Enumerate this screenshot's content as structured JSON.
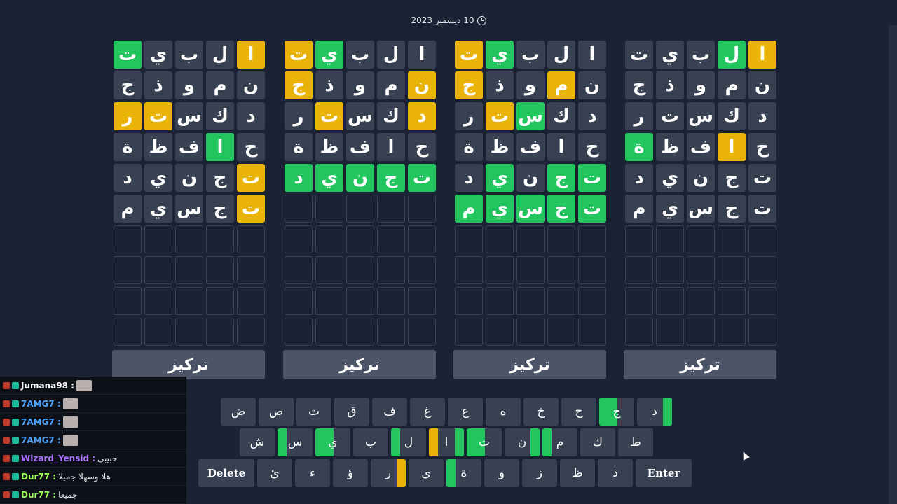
{
  "header": {
    "date": "10 ديسمبر 2023"
  },
  "boards": [
    {
      "focus_label": "تركيز",
      "rows": [
        [
          {
            "l": "ا",
            "s": "y"
          },
          {
            "l": "ل",
            "s": "g"
          },
          {
            "l": "ب",
            "s": "c"
          },
          {
            "l": "ي",
            "s": "c"
          },
          {
            "l": "ت",
            "s": "c"
          }
        ],
        [
          {
            "l": "ن",
            "s": "c"
          },
          {
            "l": "م",
            "s": "c"
          },
          {
            "l": "و",
            "s": "c"
          },
          {
            "l": "ذ",
            "s": "c"
          },
          {
            "l": "ج",
            "s": "c"
          }
        ],
        [
          {
            "l": "د",
            "s": "c"
          },
          {
            "l": "ك",
            "s": "c"
          },
          {
            "l": "س",
            "s": "c"
          },
          {
            "l": "ت",
            "s": "c"
          },
          {
            "l": "ر",
            "s": "c"
          }
        ],
        [
          {
            "l": "ح",
            "s": "c"
          },
          {
            "l": "ا",
            "s": "y"
          },
          {
            "l": "ف",
            "s": "c"
          },
          {
            "l": "ظ",
            "s": "c"
          },
          {
            "l": "ة",
            "s": "g"
          }
        ],
        [
          {
            "l": "ت",
            "s": "c"
          },
          {
            "l": "ج",
            "s": "c"
          },
          {
            "l": "ن",
            "s": "c"
          },
          {
            "l": "ي",
            "s": "c"
          },
          {
            "l": "د",
            "s": "c"
          }
        ],
        [
          {
            "l": "ت",
            "s": "c"
          },
          {
            "l": "ج",
            "s": "c"
          },
          {
            "l": "س",
            "s": "c"
          },
          {
            "l": "ي",
            "s": "c"
          },
          {
            "l": "م",
            "s": "c"
          }
        ]
      ]
    },
    {
      "focus_label": "تركيز",
      "rows": [
        [
          {
            "l": "ا",
            "s": "c"
          },
          {
            "l": "ل",
            "s": "c"
          },
          {
            "l": "ب",
            "s": "c"
          },
          {
            "l": "ي",
            "s": "g"
          },
          {
            "l": "ت",
            "s": "y"
          }
        ],
        [
          {
            "l": "ن",
            "s": "c"
          },
          {
            "l": "م",
            "s": "y"
          },
          {
            "l": "و",
            "s": "c"
          },
          {
            "l": "ذ",
            "s": "c"
          },
          {
            "l": "ج",
            "s": "y"
          }
        ],
        [
          {
            "l": "د",
            "s": "c"
          },
          {
            "l": "ك",
            "s": "c"
          },
          {
            "l": "س",
            "s": "g"
          },
          {
            "l": "ت",
            "s": "y"
          },
          {
            "l": "ر",
            "s": "c"
          }
        ],
        [
          {
            "l": "ح",
            "s": "c"
          },
          {
            "l": "ا",
            "s": "c"
          },
          {
            "l": "ف",
            "s": "c"
          },
          {
            "l": "ظ",
            "s": "c"
          },
          {
            "l": "ة",
            "s": "c"
          }
        ],
        [
          {
            "l": "ت",
            "s": "g"
          },
          {
            "l": "ج",
            "s": "g"
          },
          {
            "l": "ن",
            "s": "c"
          },
          {
            "l": "ي",
            "s": "g"
          },
          {
            "l": "د",
            "s": "c"
          }
        ],
        [
          {
            "l": "ت",
            "s": "g"
          },
          {
            "l": "ج",
            "s": "g"
          },
          {
            "l": "س",
            "s": "g"
          },
          {
            "l": "ي",
            "s": "g"
          },
          {
            "l": "م",
            "s": "g"
          }
        ]
      ]
    },
    {
      "focus_label": "تركيز",
      "rows": [
        [
          {
            "l": "ا",
            "s": "c"
          },
          {
            "l": "ل",
            "s": "c"
          },
          {
            "l": "ب",
            "s": "c"
          },
          {
            "l": "ي",
            "s": "g"
          },
          {
            "l": "ت",
            "s": "y"
          }
        ],
        [
          {
            "l": "ن",
            "s": "y"
          },
          {
            "l": "م",
            "s": "c"
          },
          {
            "l": "و",
            "s": "c"
          },
          {
            "l": "ذ",
            "s": "c"
          },
          {
            "l": "ج",
            "s": "y"
          }
        ],
        [
          {
            "l": "د",
            "s": "y"
          },
          {
            "l": "ك",
            "s": "c"
          },
          {
            "l": "س",
            "s": "c"
          },
          {
            "l": "ت",
            "s": "y"
          },
          {
            "l": "ر",
            "s": "c"
          }
        ],
        [
          {
            "l": "ح",
            "s": "c"
          },
          {
            "l": "ا",
            "s": "c"
          },
          {
            "l": "ف",
            "s": "c"
          },
          {
            "l": "ظ",
            "s": "c"
          },
          {
            "l": "ة",
            "s": "c"
          }
        ],
        [
          {
            "l": "ت",
            "s": "g"
          },
          {
            "l": "ج",
            "s": "g"
          },
          {
            "l": "ن",
            "s": "g"
          },
          {
            "l": "ي",
            "s": "g"
          },
          {
            "l": "د",
            "s": "g"
          }
        ]
      ]
    },
    {
      "focus_label": "تركيز",
      "rows": [
        [
          {
            "l": "ا",
            "s": "y"
          },
          {
            "l": "ل",
            "s": "c"
          },
          {
            "l": "ب",
            "s": "c"
          },
          {
            "l": "ي",
            "s": "c"
          },
          {
            "l": "ت",
            "s": "g"
          }
        ],
        [
          {
            "l": "ن",
            "s": "c"
          },
          {
            "l": "م",
            "s": "c"
          },
          {
            "l": "و",
            "s": "c"
          },
          {
            "l": "ذ",
            "s": "c"
          },
          {
            "l": "ج",
            "s": "c"
          }
        ],
        [
          {
            "l": "د",
            "s": "c"
          },
          {
            "l": "ك",
            "s": "c"
          },
          {
            "l": "س",
            "s": "c"
          },
          {
            "l": "ت",
            "s": "y"
          },
          {
            "l": "ر",
            "s": "y"
          }
        ],
        [
          {
            "l": "ح",
            "s": "c"
          },
          {
            "l": "ا",
            "s": "g"
          },
          {
            "l": "ف",
            "s": "c"
          },
          {
            "l": "ظ",
            "s": "c"
          },
          {
            "l": "ة",
            "s": "c"
          }
        ],
        [
          {
            "l": "ت",
            "s": "y"
          },
          {
            "l": "ج",
            "s": "c"
          },
          {
            "l": "ن",
            "s": "c"
          },
          {
            "l": "ي",
            "s": "c"
          },
          {
            "l": "د",
            "s": "c"
          }
        ],
        [
          {
            "l": "ت",
            "s": "y"
          },
          {
            "l": "ج",
            "s": "c"
          },
          {
            "l": "س",
            "s": "c"
          },
          {
            "l": "ي",
            "s": "c"
          },
          {
            "l": "م",
            "s": "c"
          }
        ]
      ]
    }
  ],
  "keyboard": {
    "row1": [
      {
        "l": "د",
        "stripes": [
          "g"
        ]
      },
      {
        "l": "ج",
        "stripes": [
          "full"
        ]
      },
      {
        "l": "ح"
      },
      {
        "l": "خ"
      },
      {
        "l": "ه"
      },
      {
        "l": "ع"
      },
      {
        "l": "غ"
      },
      {
        "l": "ف"
      },
      {
        "l": "ق"
      },
      {
        "l": "ث"
      },
      {
        "l": "ص"
      },
      {
        "l": "ض"
      }
    ],
    "row2": [
      {
        "l": "ط"
      },
      {
        "l": "ك"
      },
      {
        "l": "م",
        "stripes": [
          "g-left"
        ]
      },
      {
        "l": "ن",
        "stripes": [
          "g"
        ]
      },
      {
        "l": "ت",
        "stripes": [
          "full"
        ]
      },
      {
        "l": "ا",
        "stripes": [
          "g",
          "y-left"
        ]
      },
      {
        "l": "ل",
        "stripes": [
          "g-left"
        ]
      },
      {
        "l": "ب"
      },
      {
        "l": "ي",
        "stripes": [
          "g-center"
        ]
      },
      {
        "l": "س",
        "stripes": [
          "g-left"
        ]
      },
      {
        "l": "ش"
      }
    ],
    "row3": [
      {
        "l": "Enter",
        "wide": true
      },
      {
        "l": "ذ"
      },
      {
        "l": "ظ"
      },
      {
        "l": "ز"
      },
      {
        "l": "و"
      },
      {
        "l": "ة",
        "stripes": [
          "g-left"
        ]
      },
      {
        "l": "ى"
      },
      {
        "l": "ر",
        "stripes": [
          "y"
        ]
      },
      {
        "l": "ؤ"
      },
      {
        "l": "ء"
      },
      {
        "l": "ئ"
      },
      {
        "l": "Delete",
        "wide": true
      }
    ]
  },
  "chat": [
    {
      "user": "Jumana98",
      "color": "#ffffff",
      "msg": ""
    },
    {
      "user": "7AMG7",
      "color": "#4aa3ff",
      "msg": ""
    },
    {
      "user": "7AMG7",
      "color": "#4aa3ff",
      "msg": ""
    },
    {
      "user": "7AMG7",
      "color": "#4aa3ff",
      "msg": ""
    },
    {
      "user": "Wizard_Yensid",
      "color": "#a970ff",
      "msg": "حبيبي"
    },
    {
      "user": "Dur77",
      "color": "#9cff57",
      "msg": "هلا وسهلا جميلا"
    },
    {
      "user": "Dur77",
      "color": "#9cff57",
      "msg": "جميعا"
    }
  ],
  "colors": {
    "green": "#22c55e",
    "yellow": "#eab308",
    "cell": "#374152"
  }
}
